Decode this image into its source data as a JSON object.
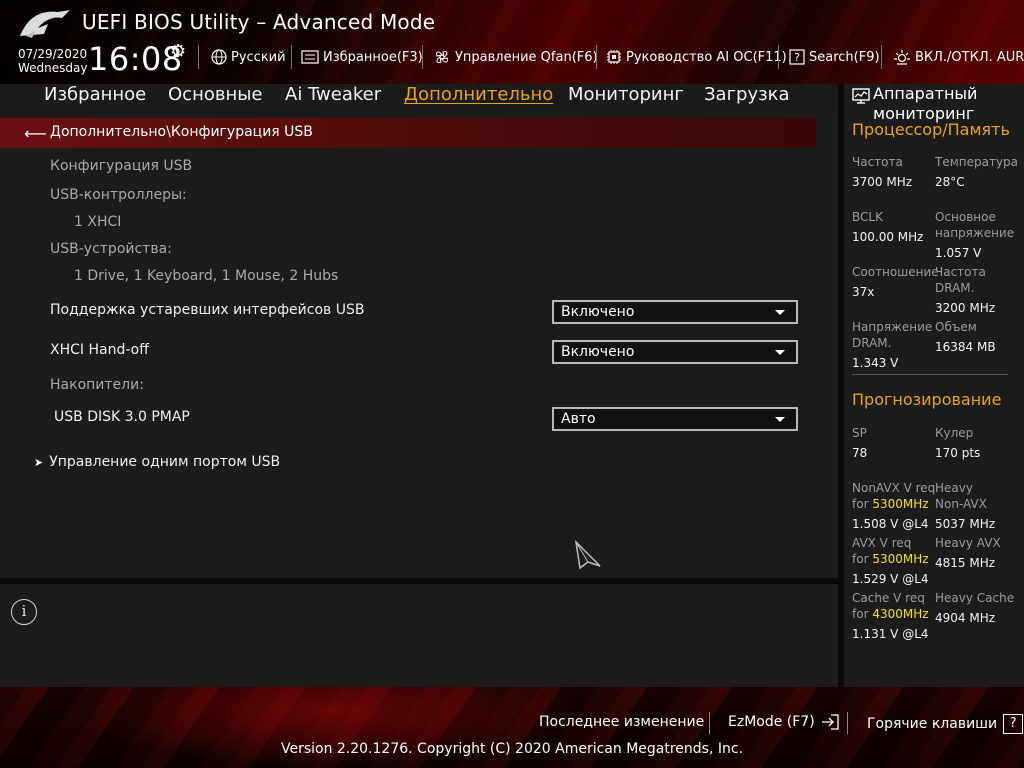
{
  "app": {
    "title": "UEFI BIOS Utility – Advanced Mode",
    "date": "07/29/2020",
    "weekday": "Wednesday",
    "time": "16:08"
  },
  "toolbar": {
    "language": "Русский",
    "favorites": "Избранное(F3)",
    "qfan": "Управление Qfan(F6)",
    "ai_oc": "Руководство AI OC(F11)",
    "search": "Search(F9)",
    "aura": "ВКЛ./ОТКЛ. AURA("
  },
  "tabs": [
    {
      "label": "Избранное",
      "active": false
    },
    {
      "label": "Основные",
      "active": false
    },
    {
      "label": "Ai Tweaker",
      "active": false
    },
    {
      "label": "Дополнительно",
      "active": true
    },
    {
      "label": "Мониторинг",
      "active": false
    },
    {
      "label": "Загрузка",
      "active": false
    }
  ],
  "main": {
    "breadcrumb": "Дополнительно\\Конфигурация USB",
    "section_title": "Конфигурация USB",
    "usb_controllers_label": "USB-контроллеры:",
    "usb_controllers_value": "1 XHCI",
    "usb_devices_label": "USB-устройства:",
    "usb_devices_value": "1 Drive, 1 Keyboard, 1 Mouse, 2 Hubs",
    "legacy_usb": {
      "label": "Поддержка устаревших интерфейсов USB",
      "value": "Включено"
    },
    "xhci_handoff": {
      "label": "XHCI Hand-off",
      "value": "Включено"
    },
    "storage_label": "Накопители:",
    "usb_disk": {
      "label": "USB DISK 3.0 PMAP",
      "value": "Авто"
    },
    "single_port": "Управление одним портом USB"
  },
  "monitor": {
    "title": "Аппаратный мониторинг",
    "cpu_mem_section": "Процессор/Память",
    "frequency_label": "Частота",
    "frequency_value": "3700 MHz",
    "temperature_label": "Температура",
    "temperature_value": "28°C",
    "bclk_label": "BCLK",
    "bclk_value": "100.00 MHz",
    "core_voltage_label_1": "Основное",
    "core_voltage_label_2": "напряжение",
    "core_voltage_value": "1.057 V",
    "ratio_label": "Соотношение",
    "ratio_value": "37x",
    "dram_freq_label_1": "Частота",
    "dram_freq_label_2": "DRAM.",
    "dram_freq_value": "3200 MHz",
    "dram_voltage_label_1": "Напряжение",
    "dram_voltage_label_2": "DRAM.",
    "dram_voltage_value": "1.343 V",
    "capacity_label": "Объем",
    "capacity_value": "16384 MB",
    "prediction_section": "Прогнозирование",
    "sp_label": "SP",
    "sp_value": "78",
    "cooler_label": "Кулер",
    "cooler_value": "170 pts",
    "nonavx_label": "NonAVX V req",
    "nonavx_for": "for",
    "nonavx_freq": "5300MHz",
    "nonavx_value": "1.508 V @L4",
    "heavy_nonavx_label_1": "Heavy",
    "heavy_nonavx_label_2": "Non-AVX",
    "heavy_nonavx_value": "5037 MHz",
    "avx_label": "AVX V req",
    "avx_for": "for",
    "avx_freq": "5300MHz",
    "avx_value": "1.529 V @L4",
    "heavy_avx_label": "Heavy AVX",
    "heavy_avx_value": "4815 MHz",
    "cache_label": "Cache V req",
    "cache_for": "for",
    "cache_freq": "4300MHz",
    "cache_value": "1.131 V @L4",
    "heavy_cache_label": "Heavy Cache",
    "heavy_cache_value": "4904 MHz"
  },
  "footer": {
    "last_change": "Последнее изменение",
    "ezmode": "EzMode (F7)",
    "hotkeys": "Горячие клавиши",
    "hotkeys_key": "?",
    "copyright": "Version 2.20.1276. Copyright (C) 2020 American Megatrends, Inc."
  },
  "colors": {
    "accent": "#e8a317",
    "highlight_yellow": "#f0e020",
    "breadcrumb_red": "#6b1010"
  }
}
